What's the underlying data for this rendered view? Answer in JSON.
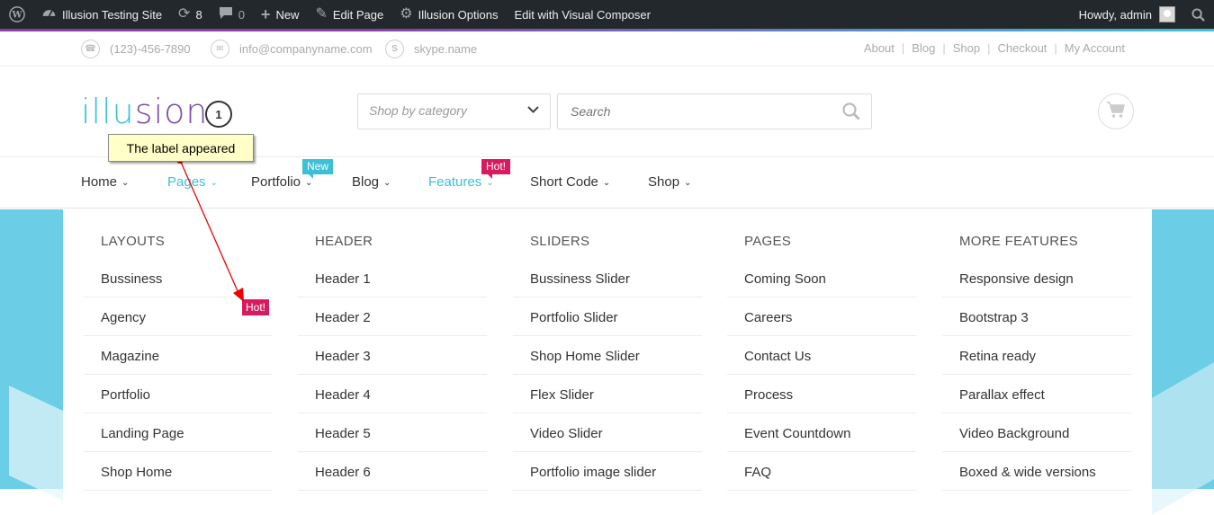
{
  "adminbar": {
    "site_name": "Illusion Testing Site",
    "updates_count": "8",
    "comments_count": "0",
    "new_label": "New",
    "edit_page_label": "Edit Page",
    "options_label": "Illusion Options",
    "visual_composer_label": "Edit with Visual Composer",
    "howdy": "Howdy, admin"
  },
  "topbar": {
    "phone": "(123)-456-7890",
    "email": "info@companyname.com",
    "skype": "skype.name",
    "links": [
      "About",
      "Blog",
      "Shop",
      "Checkout",
      "My Account"
    ]
  },
  "header": {
    "logo_part1": "illu",
    "logo_part2": "sion",
    "step_number": "1",
    "category_placeholder": "Shop by category",
    "search_placeholder": "Search"
  },
  "nav": {
    "items": [
      "Home",
      "Pages",
      "Portfolio",
      "Blog",
      "Features",
      "Short Code",
      "Shop"
    ],
    "badge_new": "New",
    "badge_hot": "Hot!"
  },
  "mega": {
    "layouts": {
      "title": "LAYOUTS",
      "items": [
        "Bussiness",
        "Agency",
        "Magazine",
        "Portfolio",
        "Landing Page",
        "Shop Home"
      ]
    },
    "header": {
      "title": "HEADER",
      "items": [
        "Header 1",
        "Header 2",
        "Header 3",
        "Header 4",
        "Header 5",
        "Header 6"
      ]
    },
    "sliders": {
      "title": "SLIDERS",
      "items": [
        "Bussiness Slider",
        "Portfolio Slider",
        "Shop Home Slider",
        "Flex Slider",
        "Video Slider",
        "Portfolio image slider"
      ]
    },
    "pages": {
      "title": "PAGES",
      "items": [
        "Coming Soon",
        "Careers",
        "Contact Us",
        "Process",
        "Event Countdown",
        "FAQ"
      ]
    },
    "more": {
      "title": "MORE FEATURES",
      "items": [
        "Responsive design",
        "Bootstrap 3",
        "Retina ready",
        "Parallax effect",
        "Video Background",
        "Boxed & wide versions"
      ]
    }
  },
  "annotation": {
    "label": "The label appeared",
    "hot_badge": "Hot!"
  },
  "colors": {
    "accent": "#3cc0d8",
    "hot": "#d81b60",
    "brand_purple": "#7b4da8",
    "hero": "#6ccde6"
  }
}
